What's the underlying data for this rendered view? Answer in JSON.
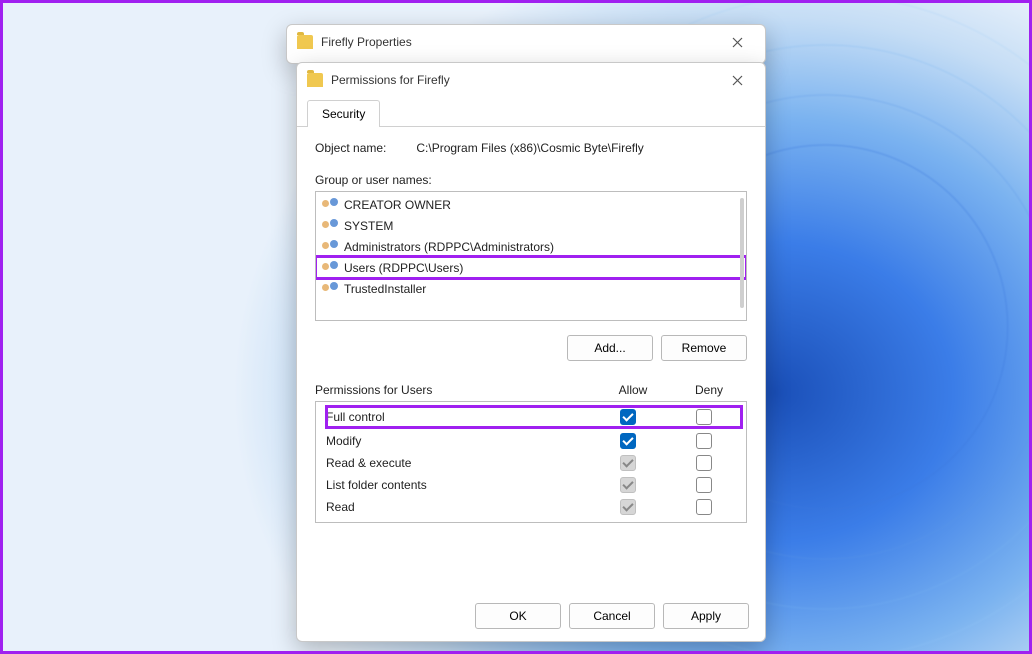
{
  "windows": {
    "properties": {
      "title": "Firefly Properties"
    },
    "permissions": {
      "title": "Permissions for Firefly",
      "tab": "Security",
      "object_name_label": "Object name:",
      "object_name_value": "C:\\Program Files (x86)\\Cosmic Byte\\Firefly",
      "group_label": "Group or user names:",
      "groups": [
        {
          "name": "CREATOR OWNER",
          "highlight": false
        },
        {
          "name": "SYSTEM",
          "highlight": false
        },
        {
          "name": "Administrators (RDPPC\\Administrators)",
          "highlight": false
        },
        {
          "name": "Users (RDPPC\\Users)",
          "highlight": true
        },
        {
          "name": "TrustedInstaller",
          "highlight": false
        }
      ],
      "buttons": {
        "add": "Add...",
        "remove": "Remove"
      },
      "perm_header": {
        "title": "Permissions for Users",
        "allow": "Allow",
        "deny": "Deny"
      },
      "permissions_list": [
        {
          "name": "Full control",
          "allow": "checked",
          "deny": "unchecked",
          "highlight": true
        },
        {
          "name": "Modify",
          "allow": "checked",
          "deny": "unchecked",
          "highlight": false
        },
        {
          "name": "Read & execute",
          "allow": "disabled-checked",
          "deny": "unchecked",
          "highlight": false
        },
        {
          "name": "List folder contents",
          "allow": "disabled-checked",
          "deny": "unchecked",
          "highlight": false
        },
        {
          "name": "Read",
          "allow": "disabled-checked",
          "deny": "unchecked",
          "highlight": false
        }
      ],
      "dialog_buttons": {
        "ok": "OK",
        "cancel": "Cancel",
        "apply": "Apply"
      }
    }
  }
}
